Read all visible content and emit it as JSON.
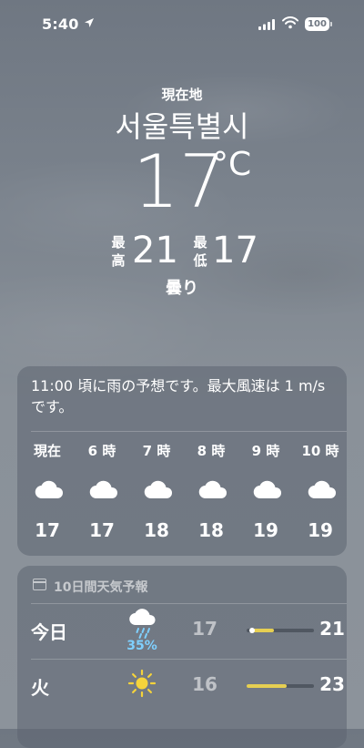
{
  "status": {
    "time": "5:40",
    "battery": "100",
    "icons": [
      "location-arrow-icon",
      "cellular-signal-icon",
      "wifi-icon",
      "battery-icon"
    ]
  },
  "location": {
    "label": "現在地",
    "city": "서울특별시"
  },
  "current": {
    "temp": "17",
    "unit": "°C",
    "high_label": "最高",
    "high": "21",
    "low_label": "最低",
    "low": "17",
    "condition": "曇り"
  },
  "hourly": {
    "summary": "11:00 頃に雨の予想です。最大風速は 1 m/s です。",
    "hours": [
      {
        "label": "現在",
        "icon": "cloud-icon",
        "temp": "17"
      },
      {
        "label": "6 時",
        "icon": "cloud-icon",
        "temp": "17"
      },
      {
        "label": "7 時",
        "icon": "cloud-icon",
        "temp": "18"
      },
      {
        "label": "8 時",
        "icon": "cloud-icon",
        "temp": "18"
      },
      {
        "label": "9 時",
        "icon": "cloud-icon",
        "temp": "19"
      },
      {
        "label": "10 時",
        "icon": "cloud-icon",
        "temp": "19"
      }
    ]
  },
  "daily": {
    "title": "10日間天気予報",
    "title_icon": "calendar-icon",
    "days": [
      {
        "name": "今日",
        "icon": "cloud-rain-icon",
        "precip": "35%",
        "low": "17",
        "high": "21",
        "range_start": 0.05,
        "range_end": 0.4,
        "current_marker": 0.05
      },
      {
        "name": "火",
        "icon": "sun-icon",
        "precip": "",
        "low": "16",
        "high": "23",
        "range_start": 0.0,
        "range_end": 0.6
      }
    ],
    "colors": {
      "range_fill": "#e6cf52",
      "precip": "#7fd0ff"
    }
  }
}
